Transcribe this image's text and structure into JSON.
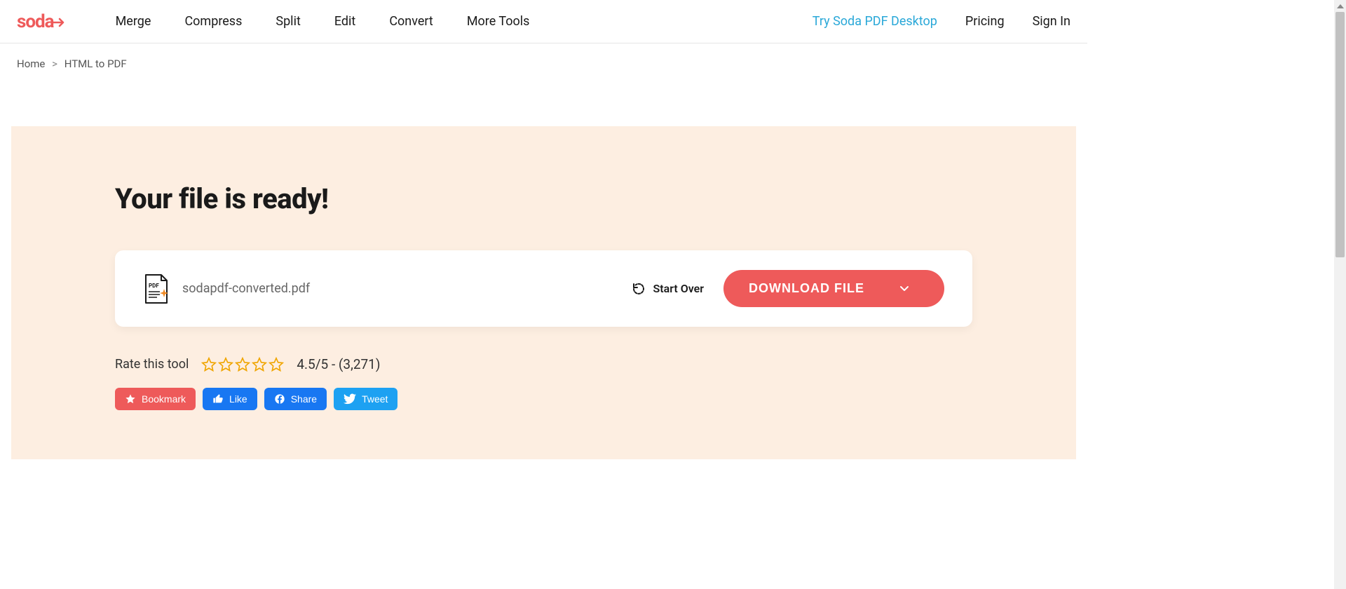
{
  "brand": "soda",
  "nav": {
    "items": [
      "Merge",
      "Compress",
      "Split",
      "Edit",
      "Convert",
      "More Tools"
    ]
  },
  "header": {
    "try_desktop": "Try Soda PDF Desktop",
    "pricing": "Pricing",
    "signin": "Sign In"
  },
  "breadcrumb": {
    "home": "Home",
    "current": "HTML to PDF"
  },
  "main": {
    "title": "Your file is ready!",
    "filename": "sodapdf-converted.pdf",
    "start_over": "Start Over",
    "download": "DOWNLOAD FILE"
  },
  "rating": {
    "label": "Rate this tool",
    "score_text": "4.5/5 - (3,271)"
  },
  "social": {
    "bookmark": "Bookmark",
    "like": "Like",
    "share": "Share",
    "tweet": "Tweet"
  },
  "colors": {
    "brand": "#ee5a5a",
    "accent_blue": "#2aa8d8",
    "panel_bg": "#fdeee1",
    "fb_blue": "#1877f2",
    "tw_blue": "#1da1f2",
    "star": "#f0a500"
  }
}
